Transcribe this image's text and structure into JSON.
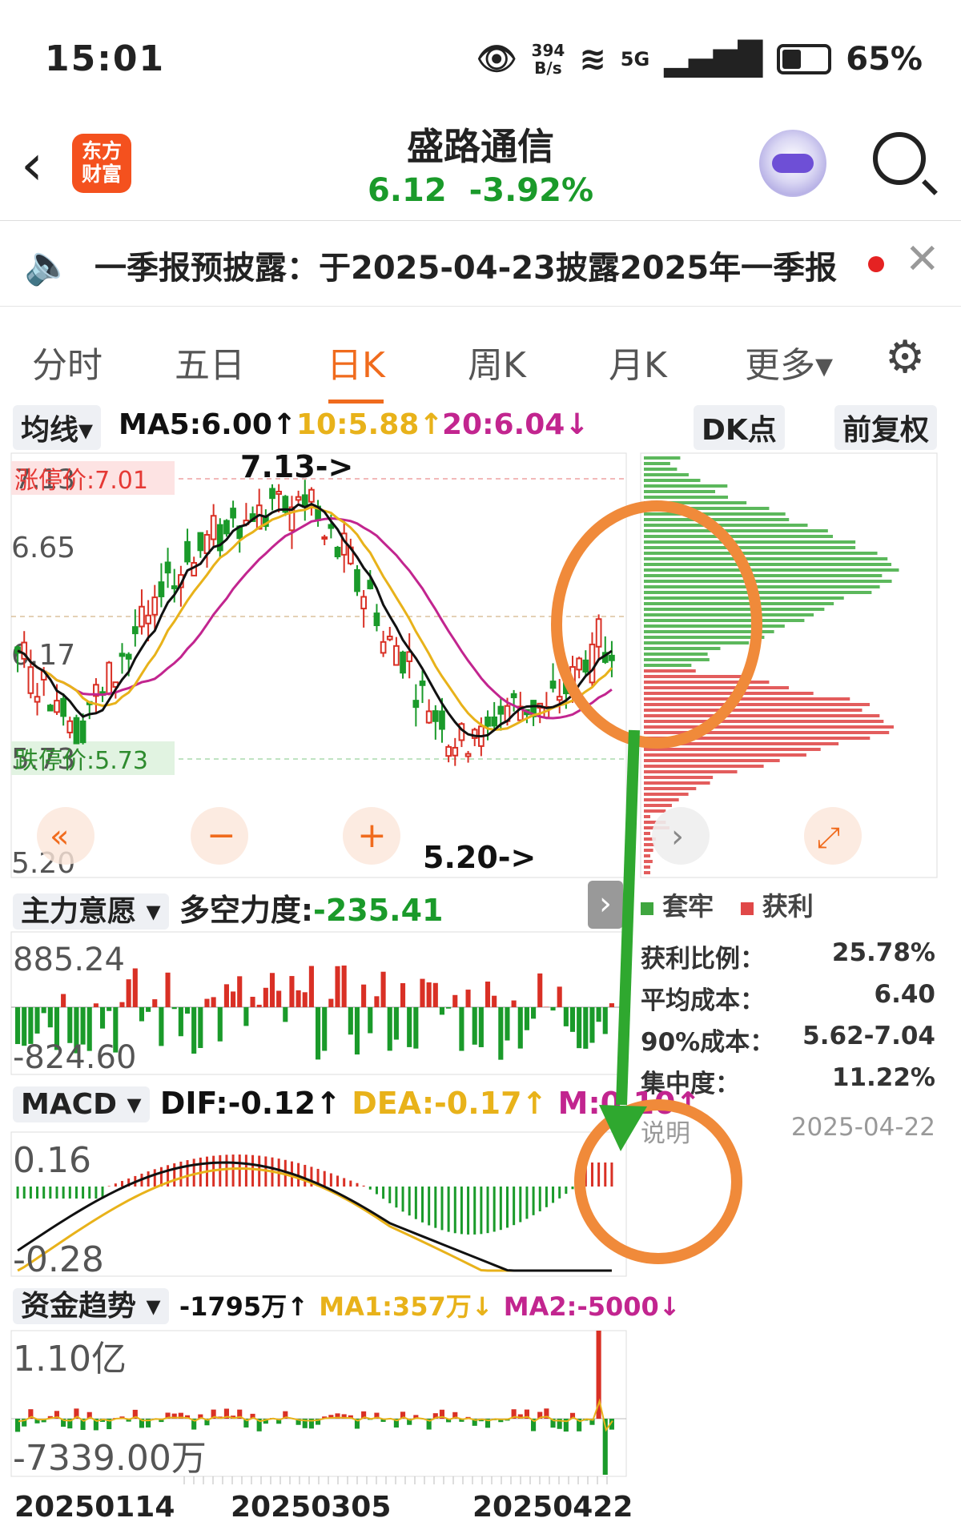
{
  "status_bar": {
    "time": "15:01",
    "net_speed_top": "394",
    "net_speed_bottom": "B/s",
    "network": "5G",
    "battery": "65%"
  },
  "header": {
    "app_logo_line1": "东方",
    "app_logo_line2": "财富",
    "stock_name": "盛路通信",
    "price": "6.12",
    "change": "-3.92%"
  },
  "notice": {
    "text": "一季报预披露：于2025-04-23披露2025年一季报"
  },
  "tabs": [
    {
      "label": "分时",
      "active": false
    },
    {
      "label": "五日",
      "active": false
    },
    {
      "label": "日K",
      "active": true
    },
    {
      "label": "周K",
      "active": false
    },
    {
      "label": "月K",
      "active": false
    },
    {
      "label": "更多▾",
      "active": false
    }
  ],
  "ma_bar": {
    "selector": "均线▾",
    "ma5": "MA5:6.00↑",
    "ma10": "10:5.88↑",
    "ma20": "20:6.04↓",
    "dk_button": "DK点",
    "adjust_button": "前复权"
  },
  "kline": {
    "y_labels": [
      "7.13",
      "6.65",
      "6.17",
      "5.73",
      "5.20"
    ],
    "limit_up_label": "涨停价:7.01",
    "limit_down_label": "跌停价:5.73",
    "high_marker": "7.13->",
    "low_marker": "5.20->",
    "chip_legend_trapped": "套牢",
    "chip_legend_profit": "获利"
  },
  "chip_stats": [
    {
      "label": "获利比例：",
      "value": "25.78%"
    },
    {
      "label": "平均成本：",
      "value": "6.40"
    },
    {
      "label": "90%成本：",
      "value": "5.62-7.04"
    },
    {
      "label": "集中度：",
      "value": "11.22%"
    }
  ],
  "chip_footer": {
    "explain": "说明",
    "date": "2025-04-22"
  },
  "main_force": {
    "selector": "主力意愿 ▾",
    "label": "多空力度:",
    "value": "-235.41",
    "y_top": "885.24",
    "y_bottom": "-824.60"
  },
  "macd": {
    "selector": "MACD ▾",
    "dif": "DIF:-0.12↑",
    "dea": "DEA:-0.17↑",
    "m": "M:0.10↑",
    "y_top": "0.16",
    "y_bottom": "-0.28"
  },
  "fund_trend": {
    "selector": "资金趋势 ▾",
    "value": "-1795万↑",
    "ma1": "MA1:357万↓",
    "ma2": "MA2:-5000↓",
    "y_top": "1.10亿",
    "y_bottom": "-7339.00万"
  },
  "date_axis": [
    "20250114",
    "20250305",
    "20250422"
  ],
  "colors": {
    "up": "#d93025",
    "down": "#1a9a2a",
    "accent": "#f06b1d",
    "ma5": "#111111",
    "ma10": "#e8b21a",
    "ma20": "#c2258f",
    "annotation_circle": "#f08a3a",
    "annotation_arrow": "#2fa82f"
  }
}
